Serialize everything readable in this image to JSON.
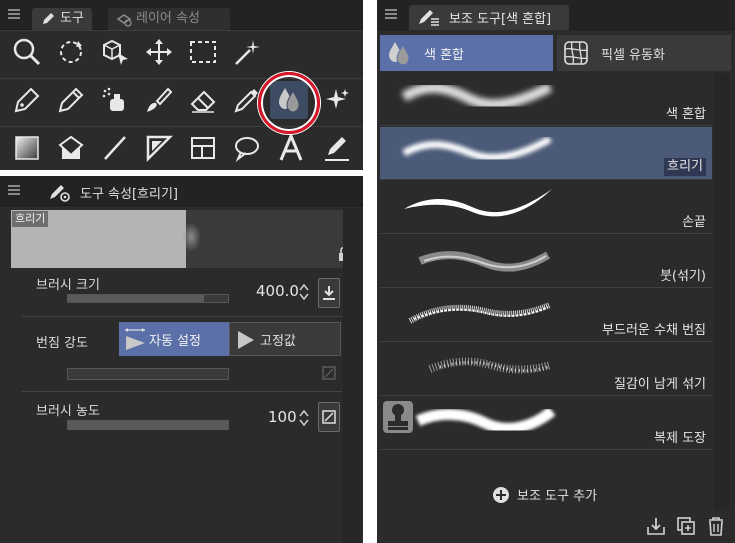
{
  "tool_panel": {
    "tabs": [
      {
        "label": "도구",
        "icon": "pen-icon"
      },
      {
        "label": "레이어 속성",
        "icon": "layer-property-icon"
      }
    ],
    "rows": [
      [
        {
          "name": "zoom-icon"
        },
        {
          "name": "rotate-icon"
        },
        {
          "name": "object-select-icon"
        },
        {
          "name": "move-icon"
        },
        {
          "name": "selection-marquee-icon"
        },
        {
          "name": "magic-wand-icon"
        }
      ],
      [
        {
          "name": "pen-tool-icon"
        },
        {
          "name": "pencil-tool-icon"
        },
        {
          "name": "airbrush-icon"
        },
        {
          "name": "brush-icon"
        },
        {
          "name": "eraser-icon"
        },
        {
          "name": "dropper-icon"
        },
        {
          "name": "blend-icon",
          "selected": true
        },
        {
          "name": "sparkle-icon"
        }
      ],
      [
        {
          "name": "gradient-icon"
        },
        {
          "name": "fill-icon"
        },
        {
          "name": "line-icon"
        },
        {
          "name": "ruler-icon"
        },
        {
          "name": "frame-border-icon"
        },
        {
          "name": "balloon-icon"
        },
        {
          "name": "text-icon"
        },
        {
          "name": "correct-line-icon"
        }
      ]
    ]
  },
  "prop_panel": {
    "title": "도구 속성[흐리기]",
    "preview_label": "흐리기",
    "brush_size": {
      "label": "브러시 크기",
      "value": "400.0",
      "fill_fraction": 0.85
    },
    "blend_strength": {
      "label": "번짐 강도",
      "options": [
        {
          "label": "자동 설정",
          "selected": true
        },
        {
          "label": "고정값",
          "selected": false
        }
      ],
      "fill_fraction": 0.0
    },
    "brush_density": {
      "label": "브러시 농도",
      "value": "100",
      "fill_fraction": 1.0
    }
  },
  "sub_panel": {
    "title": "보조 도구[색 혼합]",
    "groups": [
      {
        "label": "색 혼합",
        "selected": true,
        "icon": "blend-drops-icon"
      },
      {
        "label": "픽셀 유동화",
        "selected": false,
        "icon": "liquify-grid-icon"
      }
    ],
    "subtools": [
      {
        "label": "색 혼합",
        "selected": false
      },
      {
        "label": "흐리기",
        "selected": true
      },
      {
        "label": "손끝",
        "selected": false
      },
      {
        "label": "붓(섞기)",
        "selected": false
      },
      {
        "label": "부드러운 수채 번짐",
        "selected": false
      },
      {
        "label": "질감이 남게 섞기",
        "selected": false
      },
      {
        "label": "복제 도장",
        "selected": false
      }
    ],
    "add_label": "보조 도구 추가"
  },
  "colors": {
    "panel_bg": "#2b2b2b",
    "accent": "#5b6fa8",
    "selected_row": "#4a5a78",
    "highlight_ring": "#d7182a"
  }
}
